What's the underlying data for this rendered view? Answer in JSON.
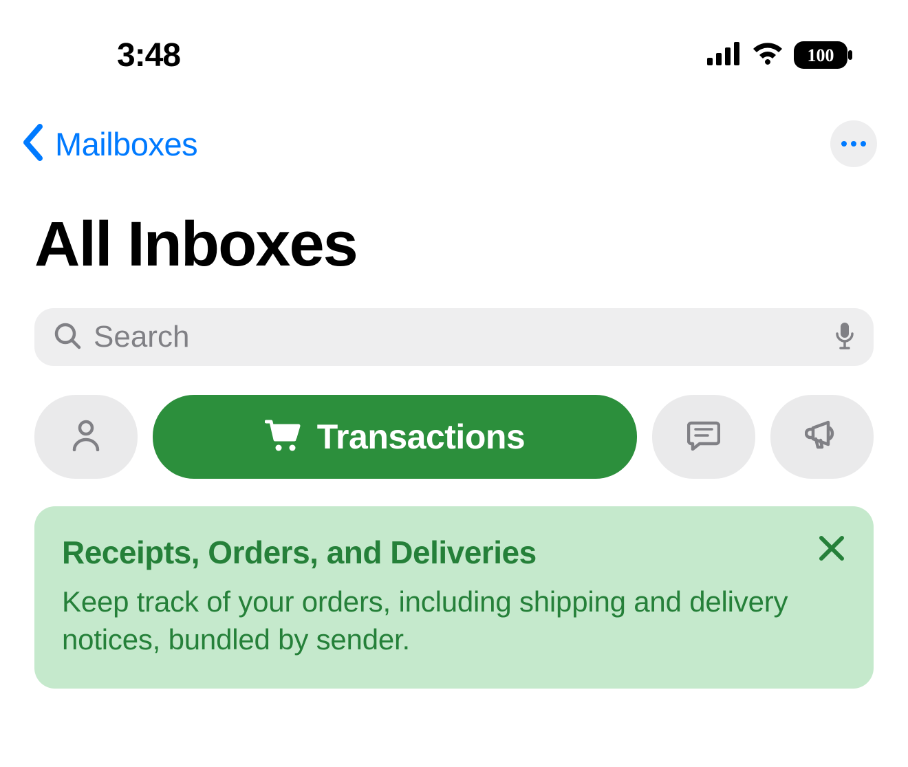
{
  "status": {
    "time": "3:48",
    "battery": "100"
  },
  "nav": {
    "back_label": "Mailboxes"
  },
  "title": "All Inboxes",
  "search": {
    "placeholder": "Search"
  },
  "pills": {
    "active_label": "Transactions"
  },
  "banner": {
    "title": "Receipts, Orders, and Deliveries",
    "body": "Keep track of your orders, including shipping and delivery notices, bundled by sender."
  },
  "colors": {
    "accent_blue": "#007aff",
    "accent_green": "#2c8f3c",
    "banner_bg": "#c5e9cc",
    "banner_text": "#258039",
    "gray_bg": "#eeeeef",
    "icon_gray": "#808085"
  }
}
